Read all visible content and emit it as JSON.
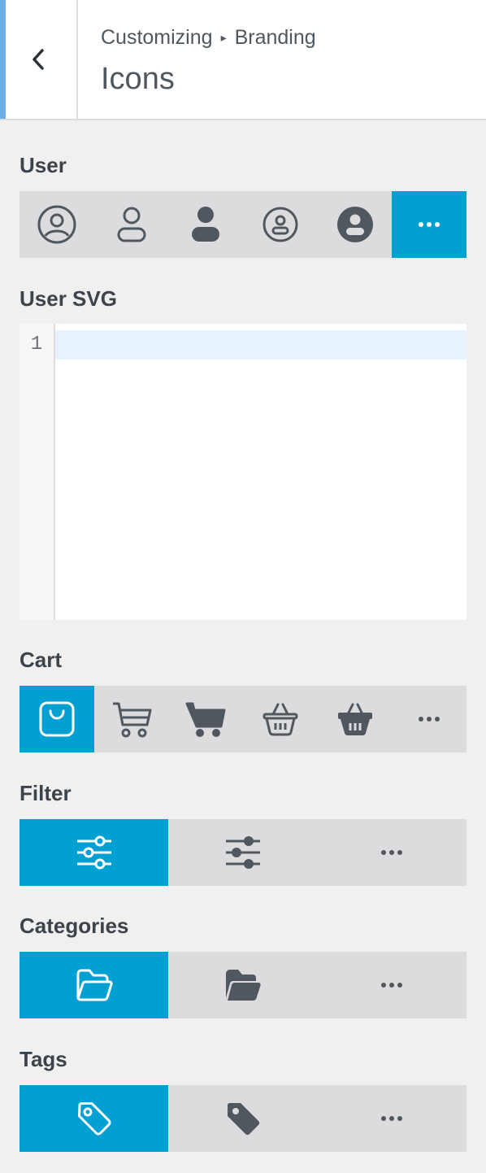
{
  "header": {
    "breadcrumb_parent": "Customizing",
    "breadcrumb_separator": "▸",
    "breadcrumb_child": "Branding",
    "title": "Icons"
  },
  "sections": {
    "user": {
      "label": "User",
      "options": [
        "user-circle-outline-icon",
        "user-outline-icon",
        "user-solid-icon",
        "user-circle-alt-icon",
        "user-circle-solid-icon",
        "more-options-icon"
      ],
      "selected_index": 5
    },
    "user_svg": {
      "label": "User SVG",
      "line_number": "1",
      "value": ""
    },
    "cart": {
      "label": "Cart",
      "options": [
        "shopping-bag-icon",
        "cart-outline-icon",
        "cart-solid-icon",
        "basket-outline-icon",
        "basket-solid-icon",
        "more-options-icon"
      ],
      "selected_index": 0
    },
    "filter": {
      "label": "Filter",
      "options": [
        "filter-sliders-outline-icon",
        "filter-sliders-solid-icon",
        "more-options-icon"
      ],
      "selected_index": 0
    },
    "categories": {
      "label": "Categories",
      "options": [
        "folder-outline-icon",
        "folder-solid-icon",
        "more-options-icon"
      ],
      "selected_index": 0
    },
    "tags": {
      "label": "Tags",
      "options": [
        "tag-outline-icon",
        "tag-solid-icon",
        "more-options-icon"
      ],
      "selected_index": 0
    }
  },
  "colors": {
    "accent": "#00a0d2",
    "icon": "#50575e",
    "segment_bg": "#dcdcde",
    "panel_bg": "#f0f0f1"
  }
}
